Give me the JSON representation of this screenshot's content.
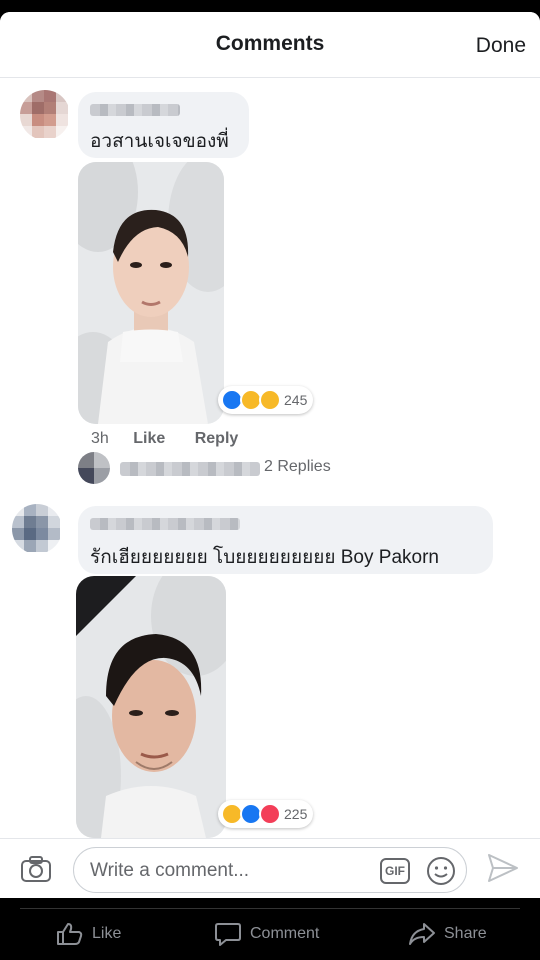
{
  "header": {
    "title": "Comments",
    "done_label": "Done"
  },
  "comments": [
    {
      "text": "อวสานเจเจของพี่",
      "reaction_count": "245",
      "time": "3h",
      "like_label": "Like",
      "reply_label": "Reply",
      "replies_label": "2 Replies"
    },
    {
      "text": "รักเฮียยยยยยย โบยยยยยยยยย Boy Pakorn",
      "reaction_count": "225"
    }
  ],
  "composer": {
    "placeholder": "Write a comment...",
    "gif_label": "GIF"
  },
  "tabbar": {
    "like": "Like",
    "comment": "Comment",
    "share": "Share"
  },
  "colors": {
    "like_blue": "#1877f2",
    "haha_yellow": "#f7b928",
    "love_red": "#f33e58",
    "text_gray": "#65676b"
  }
}
